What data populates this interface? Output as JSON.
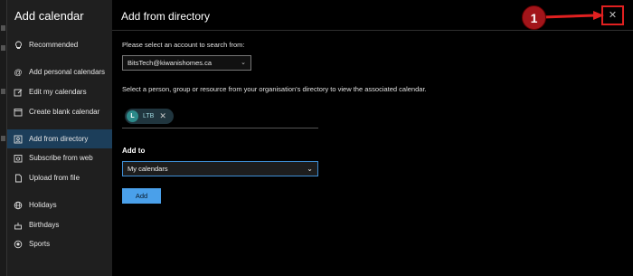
{
  "sidebar": {
    "title": "Add calendar",
    "items": [
      {
        "label": "Recommended",
        "icon": "lightbulb-icon"
      },
      {
        "label": "Add personal calendars",
        "icon": "at-sign-icon"
      },
      {
        "label": "Edit my calendars",
        "icon": "edit-calendar-icon"
      },
      {
        "label": "Create blank calendar",
        "icon": "calendar-icon"
      },
      {
        "label": "Add from directory",
        "icon": "directory-icon"
      },
      {
        "label": "Subscribe from web",
        "icon": "subscribe-icon"
      },
      {
        "label": "Upload from file",
        "icon": "file-icon"
      },
      {
        "label": "Holidays",
        "icon": "globe-icon"
      },
      {
        "label": "Birthdays",
        "icon": "birthday-icon"
      },
      {
        "label": "Sports",
        "icon": "sports-icon"
      }
    ]
  },
  "main": {
    "title": "Add from directory",
    "account_prompt": "Please select an account to search from:",
    "account_value": "BitsTech@kiwanishomes.ca",
    "directory_prompt": "Select a person, group or resource from your organisation's directory to view the associated calendar.",
    "chip": {
      "initial": "L",
      "label": "LTB"
    },
    "add_to_label": "Add to",
    "calendar_value": "My calendars",
    "add_button": "Add"
  },
  "annotation": {
    "badge": "1",
    "color": "#e02020"
  },
  "colors": {
    "accent": "#4aa0ea",
    "active_nav": "#1c3e5a",
    "highlight": "#e02020"
  }
}
